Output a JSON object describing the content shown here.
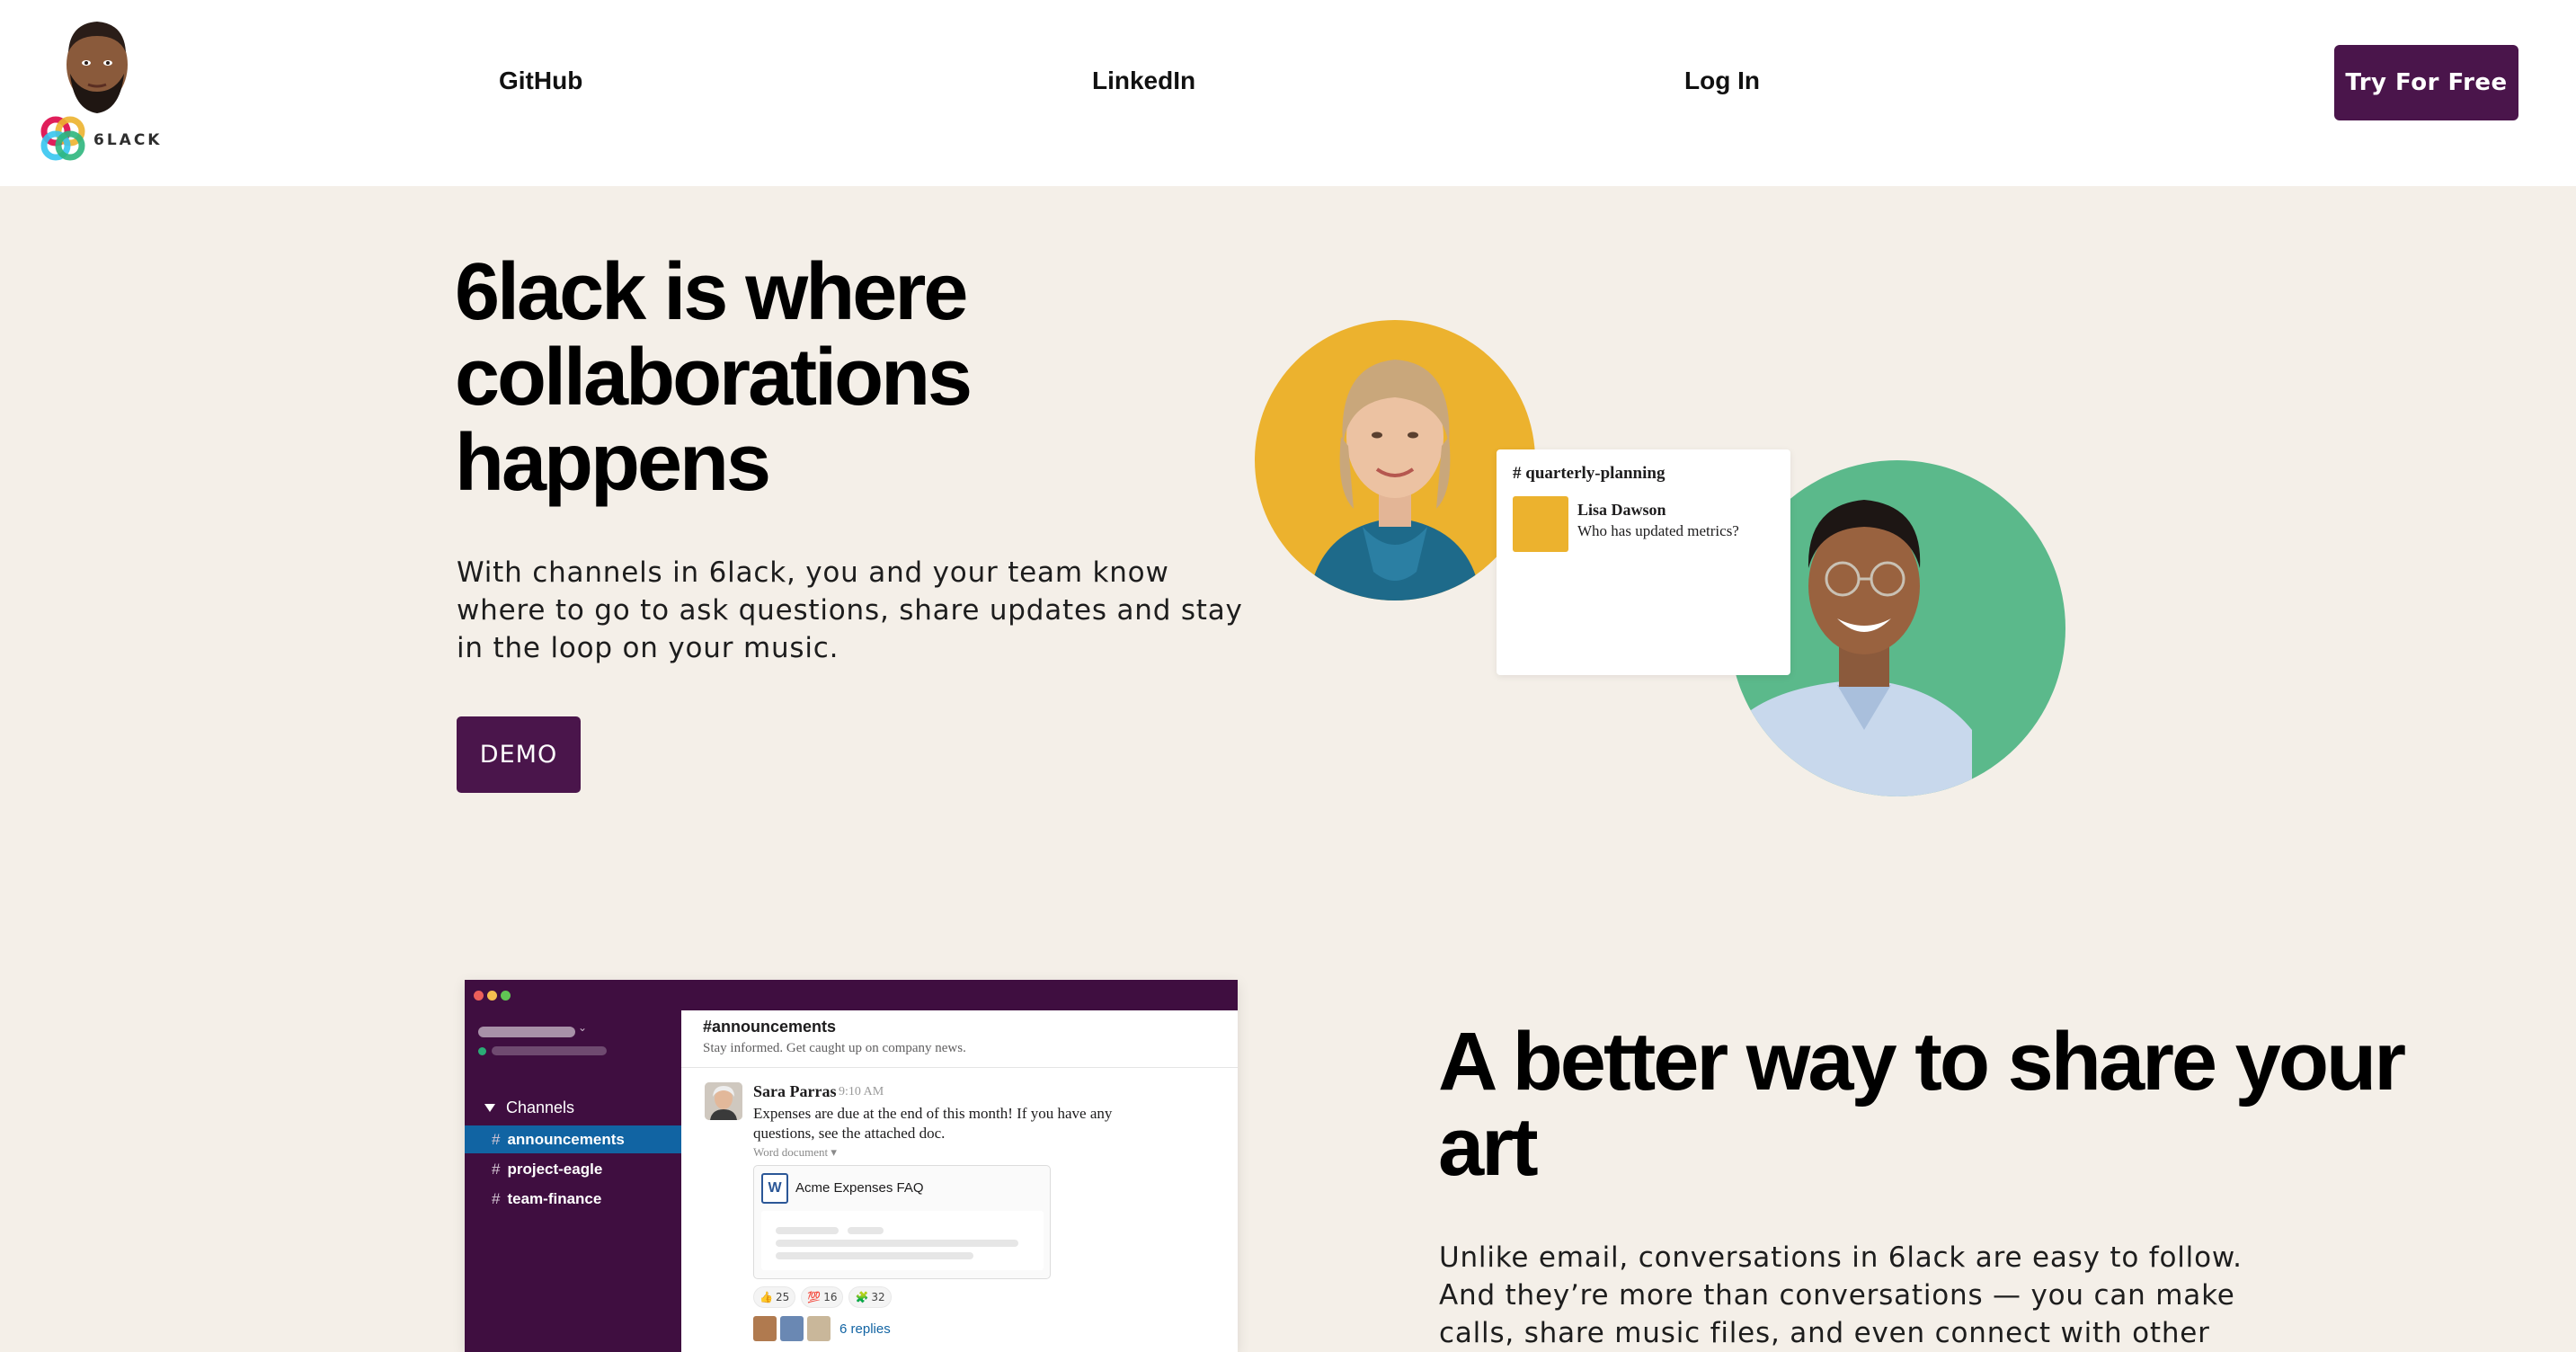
{
  "brand": {
    "name": "6LACK"
  },
  "nav": {
    "links": [
      "GitHub",
      "LinkedIn",
      "Log In"
    ],
    "cta": "Try For Free"
  },
  "hero": {
    "title": "6lack is where collaborations happens",
    "description": "With channels in 6lack, you and your team know where to go to ask questions, share updates and stay in the loop on your music.",
    "button": "DEMO",
    "chat_card": {
      "channel": "quarterly-planning",
      "author": "Lisa Dawson",
      "message": "Who has updated metrics?"
    }
  },
  "app_mock": {
    "sidebar": {
      "section": "Channels",
      "channels": [
        "announcements",
        "project-eagle",
        "team-finance"
      ],
      "active": "announcements"
    },
    "channel": "#announcements",
    "topic": "Stay informed. Get caught up on company news.",
    "message": {
      "author": "Sara Parras",
      "time": "9:10 AM",
      "text": "Expenses are due at the end of this month! If you have any questions, see the attached doc.",
      "attachment_type": "Word document",
      "attachment_name": "Acme Expenses FAQ",
      "reactions": [
        {
          "icon": "thumbs-up-icon",
          "glyph": "👍",
          "count": "25"
        },
        {
          "icon": "heart-icon",
          "glyph": "💯",
          "count": "16"
        },
        {
          "icon": "clap-icon",
          "glyph": "🧩",
          "count": "32"
        }
      ],
      "replies": "6 replies"
    }
  },
  "section2": {
    "title": "A better way to share your art",
    "description": "Unlike email, conversations in 6lack are easy to follow. And they’re more than conversations — you can make calls, share music files, and even connect with other"
  },
  "colors": {
    "aubergine": "#4a154b",
    "sidebar": "#3f0e40",
    "active_channel": "#1164a3",
    "yellow": "#ecb22e",
    "green": "#5bb98b",
    "page_bg": "#f4efe8"
  }
}
